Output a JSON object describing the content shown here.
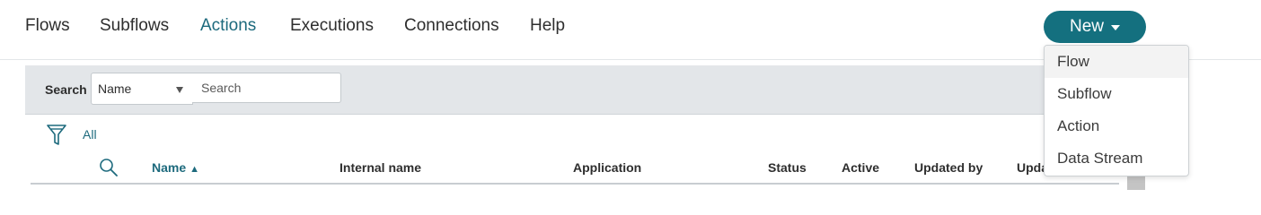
{
  "nav": {
    "items": [
      {
        "label": "Flows",
        "active": false
      },
      {
        "label": "Subflows",
        "active": false
      },
      {
        "label": "Actions",
        "active": true
      },
      {
        "label": "Executions",
        "active": false
      },
      {
        "label": "Connections",
        "active": false
      },
      {
        "label": "Help",
        "active": false
      }
    ],
    "new_button": "New"
  },
  "new_menu": {
    "items": [
      "Flow",
      "Subflow",
      "Action",
      "Data Stream"
    ],
    "highlighted": "Flow"
  },
  "search": {
    "label": "Search",
    "field_select": "Name",
    "placeholder": "Search"
  },
  "filter": {
    "label": "All",
    "icon": "funnel-icon"
  },
  "table": {
    "columns": [
      "Name",
      "Internal name",
      "Application",
      "Status",
      "Active",
      "Updated by",
      "Upda"
    ],
    "sorted_column": "Name",
    "sort_direction": "ascending",
    "search_icon": "magnifier-icon"
  },
  "colors": {
    "accent": "#14707f",
    "link": "#1d6a7d",
    "toolbar_bg": "#e3e6e9"
  }
}
